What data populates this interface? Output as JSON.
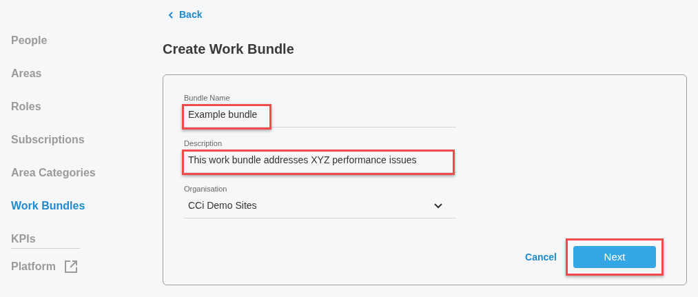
{
  "sidebar": {
    "items": [
      {
        "label": "People",
        "selected": false
      },
      {
        "label": "Areas",
        "selected": false
      },
      {
        "label": "Roles",
        "selected": false
      },
      {
        "label": "Subscriptions",
        "selected": false
      },
      {
        "label": "Area Categories",
        "selected": false
      },
      {
        "label": "Work Bundles",
        "selected": true
      },
      {
        "label": "KPIs",
        "selected": false
      }
    ],
    "external_link": {
      "label": "Platform"
    }
  },
  "back_link": "Back",
  "title": "Create Work Bundle",
  "form": {
    "fields": [
      {
        "kind": "text",
        "label": "Bundle Name",
        "value": "Example bundle",
        "highlighted": true
      },
      {
        "kind": "text",
        "label": "Description",
        "value": "This work bundle addresses XYZ performance issues",
        "highlighted": true
      },
      {
        "kind": "select",
        "label": "Organisation",
        "value": "CCi Demo Sites",
        "highlighted": false
      }
    ],
    "cancel": {
      "label": "Cancel"
    },
    "next": {
      "label": "Next",
      "highlighted": true
    }
  }
}
